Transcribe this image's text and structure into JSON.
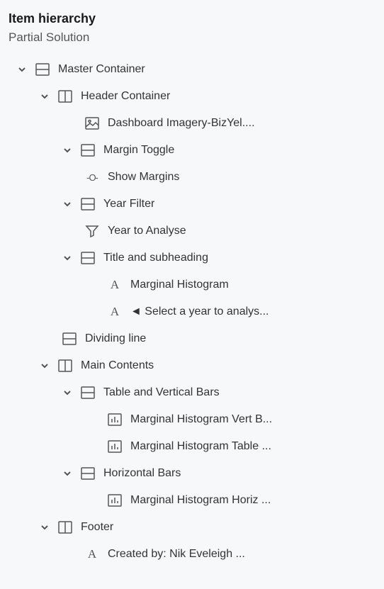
{
  "header": {
    "title": "Item hierarchy",
    "subtitle": "Partial Solution"
  },
  "tree": {
    "master": "Master Container",
    "header_container": "Header Container",
    "dashboard_imagery": "Dashboard Imagery-BizYel....",
    "margin_toggle": "Margin Toggle",
    "show_margins": "Show Margins",
    "year_filter": "Year Filter",
    "year_to_analyse": "Year to Analyse",
    "title_subheading": "Title and subheading",
    "marginal_histogram": "Marginal Histogram",
    "select_year": "◄ Select a year to analys...",
    "dividing_line": "Dividing line",
    "main_contents": "Main Contents",
    "table_vertical": "Table and Vertical Bars",
    "vert_bars": "Marginal Histogram Vert B...",
    "table_item": "Marginal Histogram Table ...",
    "horizontal_bars": "Horizontal Bars",
    "horiz_item": "Marginal Histogram Horiz ...",
    "footer": "Footer",
    "created_by": "Created by: Nik Eveleigh ..."
  }
}
